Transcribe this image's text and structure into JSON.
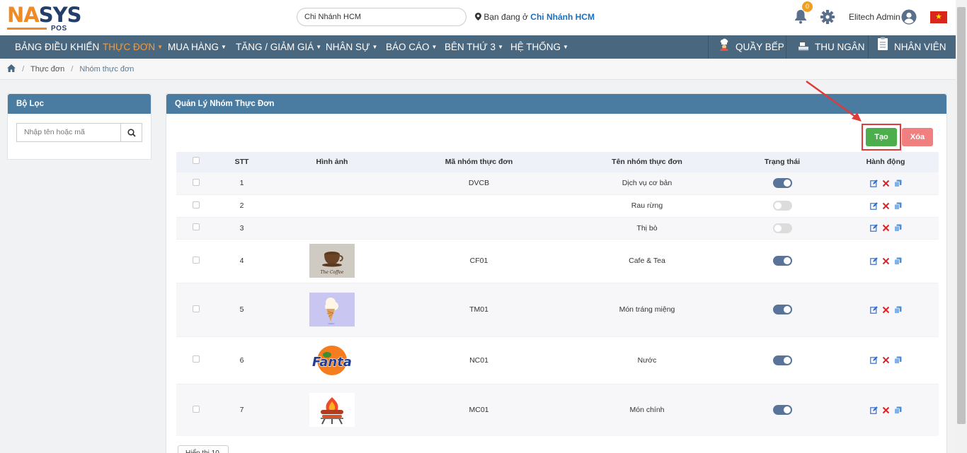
{
  "header": {
    "logo_brand_left": "NA",
    "logo_brand_s": "S",
    "logo_brand_right": "YS",
    "logo_sub": "POS",
    "branch_value": "Chi Nhánh HCM",
    "location_prefix": "Bạn đang ở",
    "location_branch": "Chi Nhánh HCM",
    "notification_count": "0",
    "user_name": "Elitech Admin"
  },
  "nav": {
    "items": [
      {
        "label": "BẢNG ĐIỀU KHIỂN"
      },
      {
        "label": "THỰC ĐƠN",
        "caret": "▼"
      },
      {
        "label": "MUA HÀNG",
        "caret": "▼"
      },
      {
        "label": "TĂNG / GIẢM GIÁ",
        "caret": "▼"
      },
      {
        "label": "NHÂN SỰ",
        "caret": "▼"
      },
      {
        "label": "BÁO CÁO",
        "caret": "▼"
      },
      {
        "label": "BÊN THỨ 3",
        "caret": "▼"
      },
      {
        "label": "HỆ THỐNG",
        "caret": "▼"
      }
    ],
    "right": [
      {
        "label": "QUẦY BẾP",
        "icon": "chef-icon"
      },
      {
        "label": "THU NGÂN",
        "icon": "cashier-icon"
      },
      {
        "label": "NHÂN VIÊN",
        "icon": "clipboard-icon"
      }
    ],
    "active_color": "#f49b3a"
  },
  "breadcrumb": {
    "home_icon": "home-icon",
    "items": [
      "Thực đơn",
      "Nhóm thực đơn"
    ]
  },
  "filter": {
    "title": "Bộ Lọc",
    "placeholder": "Nhập tên hoặc mã"
  },
  "main": {
    "title": "Quản Lý Nhóm Thực Đơn",
    "create_label": "Tạo",
    "delete_label": "Xóa",
    "columns": [
      "STT",
      "Hình ảnh",
      "Mã nhóm thực đơn",
      "Tên nhóm thực đơn",
      "Trạng thái",
      "Hành động"
    ],
    "rows": [
      {
        "stt": "1",
        "image": "",
        "code": "DVCB",
        "name": "Dịch vụ cơ bản",
        "active": true
      },
      {
        "stt": "2",
        "image": "",
        "code": "",
        "name": "Rau rừng",
        "active": false
      },
      {
        "stt": "3",
        "image": "",
        "code": "",
        "name": "Thị bò",
        "active": false
      },
      {
        "stt": "4",
        "image": "coffee-cup-image",
        "code": "CF01",
        "name": "Cafe & Tea",
        "active": true
      },
      {
        "stt": "5",
        "image": "ice-cream-image",
        "code": "TM01",
        "name": "Món tráng miệng",
        "active": true
      },
      {
        "stt": "6",
        "image": "fanta-logo-image",
        "code": "NC01",
        "name": "Nước",
        "active": true
      },
      {
        "stt": "7",
        "image": "grill-sausage-image",
        "code": "MC01",
        "name": "Món chính",
        "active": true
      }
    ],
    "pager_label": "Hiển thị 10",
    "logo_text": {
      "coffee": "The Coffee",
      "fanta": "Fanta"
    }
  },
  "colors": {
    "nav_bg": "#4a6780",
    "panel_head": "#4a7ba0",
    "create_button": "#4cae4c",
    "delete_button": "#f08080",
    "toggle_on": "#5a7499",
    "highlight": "#e03a3a"
  }
}
